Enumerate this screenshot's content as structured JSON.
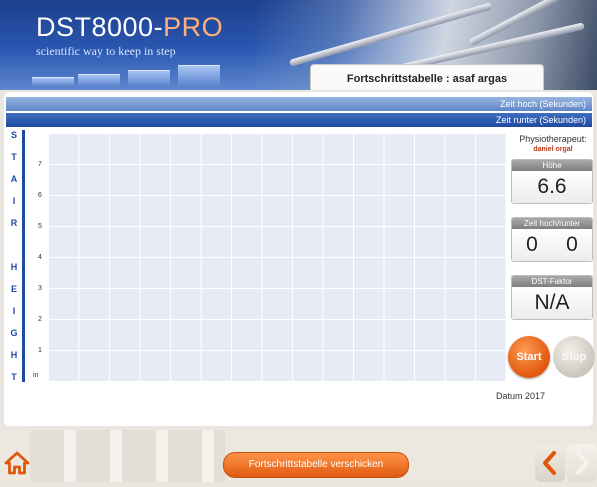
{
  "header": {
    "app_name_main": "DST8000-",
    "app_name_accent": "PRO",
    "tagline": "scientific way to keep in step",
    "page_title": "Fortschrittstabelle : asaf argas"
  },
  "bars": {
    "up_label": "Zeit hoch (Sekunden)",
    "down_label": "Zeit runter (Sekunden)"
  },
  "chart": {
    "vertical_label_letters": [
      "S",
      "T",
      "A",
      "I",
      "R",
      "",
      "H",
      "E",
      "I",
      "G",
      "H",
      "T"
    ],
    "y_ticks": [
      "7",
      "6",
      "5",
      "4",
      "3",
      "2",
      "1",
      "in"
    ]
  },
  "side": {
    "physio_label": "Physiotherapeut:",
    "physio_name": "daniel orgal",
    "height_label": "Höhe",
    "height_value": "6.6",
    "time_label": "Zeit hoch/runter",
    "time_up": "0",
    "time_down": "0",
    "dst_label": "DST-Faktor",
    "dst_value": "N/A",
    "start_label": "Start",
    "stop_label": "Stop",
    "date_label": "Datum 2017"
  },
  "footer": {
    "send_label": "Fortschrittstabelle verschicken"
  },
  "colors": {
    "header_blue": "#2a57b0",
    "accent_orange": "#e05a10",
    "label_blue": "#1f4aa0",
    "physio_red": "#c03a16"
  },
  "icons": {
    "home": "home-icon",
    "prev": "chevron-left-icon",
    "next": "chevron-right-icon"
  }
}
